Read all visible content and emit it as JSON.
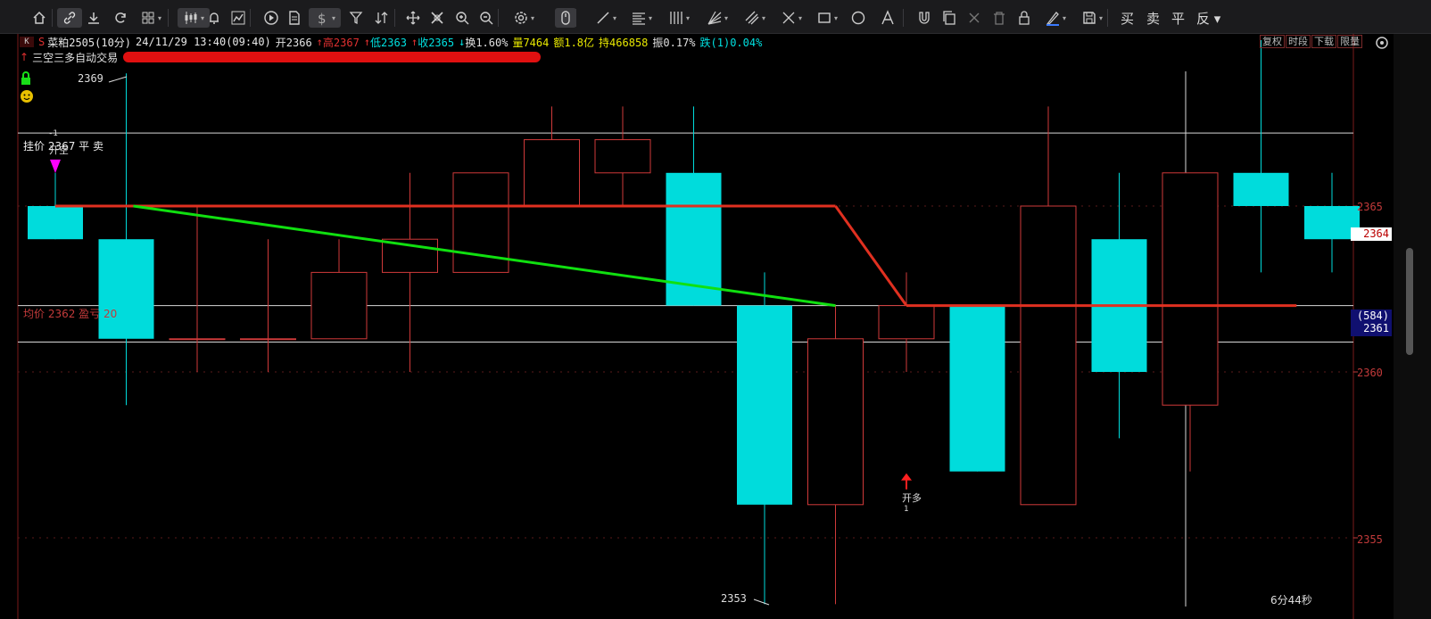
{
  "toolbar": {
    "buttons": [
      {
        "name": "home-icon",
        "icon": "home"
      },
      {
        "name": "download-icon",
        "icon": "download"
      },
      {
        "name": "refresh-icon",
        "icon": "refresh"
      },
      {
        "name": "grid-layout-icon",
        "icon": "grid"
      },
      {
        "name": "candlestick-icon",
        "icon": "candles"
      },
      {
        "name": "alarm-icon",
        "icon": "bell"
      },
      {
        "name": "indicator-icon",
        "icon": "chart"
      },
      {
        "name": "play-icon",
        "icon": "play"
      },
      {
        "name": "document-icon",
        "icon": "doc"
      },
      {
        "name": "dollar-icon",
        "icon": "dollar"
      },
      {
        "name": "filter-icon",
        "icon": "filter"
      },
      {
        "name": "sort-icon",
        "icon": "sort"
      },
      {
        "name": "move-icon",
        "icon": "move"
      },
      {
        "name": "crosshair-off-icon",
        "icon": "cross"
      },
      {
        "name": "zoom-in-icon",
        "icon": "zoomin"
      },
      {
        "name": "zoom-out-icon",
        "icon": "zoomout"
      },
      {
        "name": "settings-icon",
        "icon": "gear"
      },
      {
        "name": "mouse-icon",
        "icon": "mouse"
      },
      {
        "name": "trendline-icon",
        "icon": "line"
      },
      {
        "name": "hlines-icon",
        "icon": "hlines"
      },
      {
        "name": "vlines-icon",
        "icon": "vlines"
      },
      {
        "name": "fan-icon",
        "icon": "fan"
      },
      {
        "name": "channel-icon",
        "icon": "channel"
      },
      {
        "name": "cross-line-icon",
        "icon": "crossline"
      },
      {
        "name": "rectangle-icon",
        "icon": "rect"
      },
      {
        "name": "circle-icon",
        "icon": "circle"
      },
      {
        "name": "text-icon",
        "icon": "text"
      },
      {
        "name": "magnet-icon",
        "icon": "magnet"
      },
      {
        "name": "copy-icon",
        "icon": "copy"
      },
      {
        "name": "delete-icon",
        "icon": "x"
      },
      {
        "name": "trash-icon",
        "icon": "trash"
      },
      {
        "name": "lock-icon",
        "icon": "lock"
      },
      {
        "name": "color-icon",
        "icon": "pen"
      },
      {
        "name": "save-icon",
        "icon": "save"
      }
    ],
    "trade": {
      "buy": "买",
      "sell": "卖",
      "close": "平",
      "reverse": "反"
    }
  },
  "info": {
    "symbol": "菜粕2505(10分)",
    "datetime": "24/11/29 13:40(09:40)",
    "open": "开2366",
    "high": "高2367",
    "low": "低2363",
    "close": "收2365",
    "turnover": "换1.60%",
    "volume": "量7464",
    "amount": "额1.8亿",
    "open_interest": "持466858",
    "amplitude": "振0.17%",
    "change": "跌(1)0.04%",
    "k_label": "K",
    "s_label": "S"
  },
  "strategy": {
    "name": "三空三多自动交易"
  },
  "right_buttons": {
    "restore": "复权",
    "timeline": "时段",
    "download": "下载",
    "limit": "限量"
  },
  "annotations": {
    "high_marker": "2369",
    "low_marker": "2353",
    "order_label": "挂价 2367 平 卖",
    "avg_label": "均价 2362 盈亏 20",
    "buy_label": "开多",
    "sell_label": "开空",
    "countdown": "6分44秒",
    "sell_num": "-1",
    "buy_num": "1"
  },
  "axis": {
    "ticks": [
      {
        "value": 2365,
        "label": "2365"
      },
      {
        "value": 2360,
        "label": "2360"
      },
      {
        "value": 2355,
        "label": "2355"
      }
    ],
    "current_price": "2364",
    "position_qty": "(584)",
    "position_price": "2361"
  },
  "colors": {
    "up": "#d03a3a",
    "down": "#00dcdc",
    "green_line": "#10e010",
    "red_line": "#e03020",
    "grid": "#5a1a1a",
    "accent_red": "#c23a3a"
  },
  "chart_data": {
    "type": "candlestick",
    "title": "",
    "ylim": [
      2352.5,
      2371
    ],
    "candles": [
      {
        "o": 2365,
        "h": 2366,
        "l": 2364,
        "c": 2364
      },
      {
        "o": 2364,
        "h": 2369,
        "l": 2359,
        "c": 2361
      },
      {
        "o": 2361,
        "h": 2365,
        "l": 2360,
        "c": 2361
      },
      {
        "o": 2361,
        "h": 2364,
        "l": 2360,
        "c": 2361
      },
      {
        "o": 2361,
        "h": 2364,
        "l": 2361,
        "c": 2363
      },
      {
        "o": 2363,
        "h": 2366,
        "l": 2360,
        "c": 2364
      },
      {
        "o": 2363,
        "h": 2366,
        "l": 2363,
        "c": 2366
      },
      {
        "o": 2365,
        "h": 2368,
        "l": 2365,
        "c": 2367
      },
      {
        "o": 2366,
        "h": 2368,
        "l": 2365,
        "c": 2367
      },
      {
        "o": 2366,
        "h": 2368,
        "l": 2362,
        "c": 2362
      },
      {
        "o": 2362,
        "h": 2363,
        "l": 2353,
        "c": 2356
      },
      {
        "o": 2356,
        "h": 2362,
        "l": 2353,
        "c": 2361
      },
      {
        "o": 2361,
        "h": 2363,
        "l": 2360,
        "c": 2362
      },
      {
        "o": 2362,
        "h": 2362,
        "l": 2357,
        "c": 2357
      },
      {
        "o": 2356,
        "h": 2368,
        "l": 2356,
        "c": 2365
      },
      {
        "o": 2364,
        "h": 2366,
        "l": 2358,
        "c": 2360
      },
      {
        "o": 2359,
        "h": 2366,
        "l": 2357,
        "c": 2366
      },
      {
        "o": 2366,
        "h": 2370,
        "l": 2363,
        "c": 2365
      },
      {
        "o": 2365,
        "h": 2366,
        "l": 2363,
        "c": 2364
      }
    ],
    "horizontal_lines": [
      2367.2,
      2362,
      2360.9
    ],
    "cursor_candle_index": 16
  }
}
